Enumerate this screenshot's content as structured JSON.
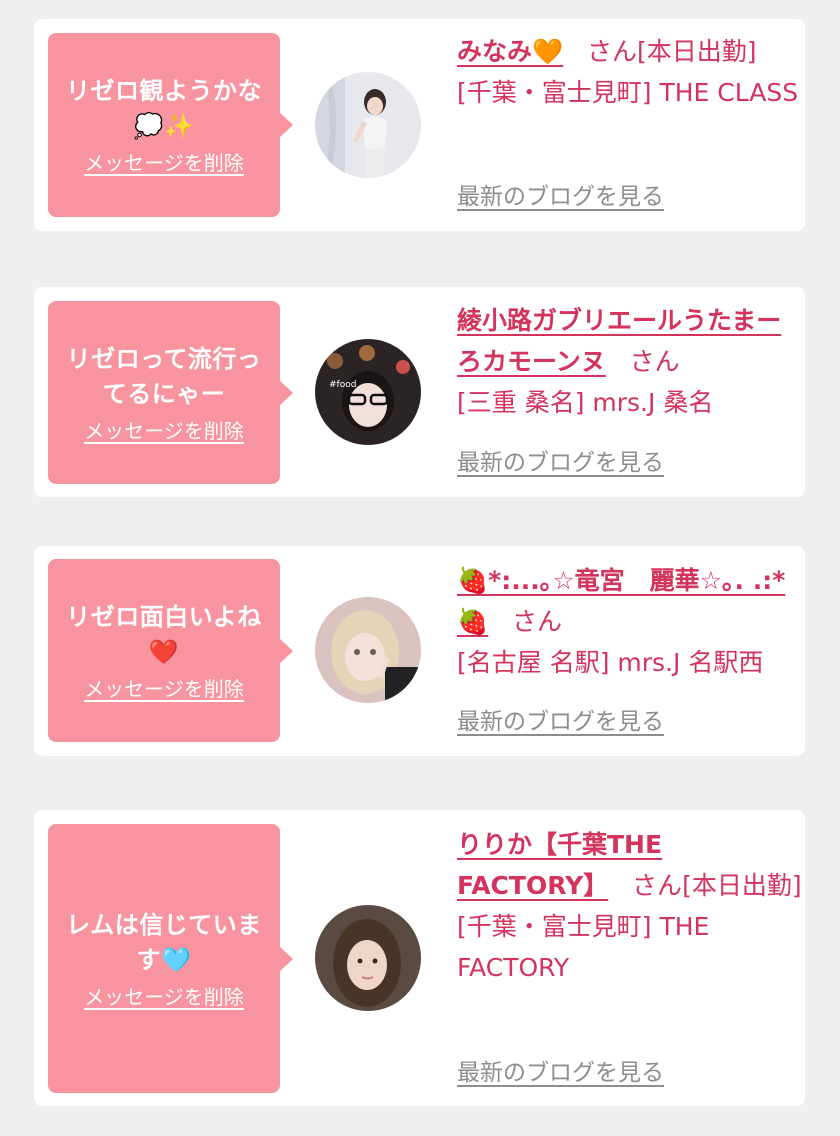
{
  "common": {
    "delete_label": "メッセージを削除",
    "blog_label": "最新のブログを見る",
    "san": "さん"
  },
  "messages": [
    {
      "text": "リゼロ観ようかな",
      "text_emoji": "💭✨",
      "name": "みなみ🧡",
      "suffix": "[本日出勤]",
      "shop": "[千葉・富士見町] THE CLASS"
    },
    {
      "text": "リゼロって流行ってるにゃー",
      "text_emoji": "",
      "name": "綾小路ガブリエールうたまーろカモーンヌ",
      "suffix": "",
      "shop": "[三重 桑名] mrs.J 桑名"
    },
    {
      "text": "リゼロ面白いよね",
      "text_emoji": "❤️",
      "name": "🍓*:...｡☆竜宮　麗華☆｡. .:*🍓",
      "suffix": "",
      "shop": "[名古屋 名駅] mrs.J 名駅西"
    },
    {
      "text": "レムは信じています",
      "text_emoji": "🩵",
      "name": "りりか【千葉THE FACTORY】",
      "suffix": "[本日出勤]",
      "shop": "[千葉・富士見町] THE FACTORY"
    }
  ],
  "colors": {
    "bubble": "#f8949f",
    "accent": "#d3335c",
    "link_gray": "#8d8d8d",
    "background": "#efefef"
  }
}
